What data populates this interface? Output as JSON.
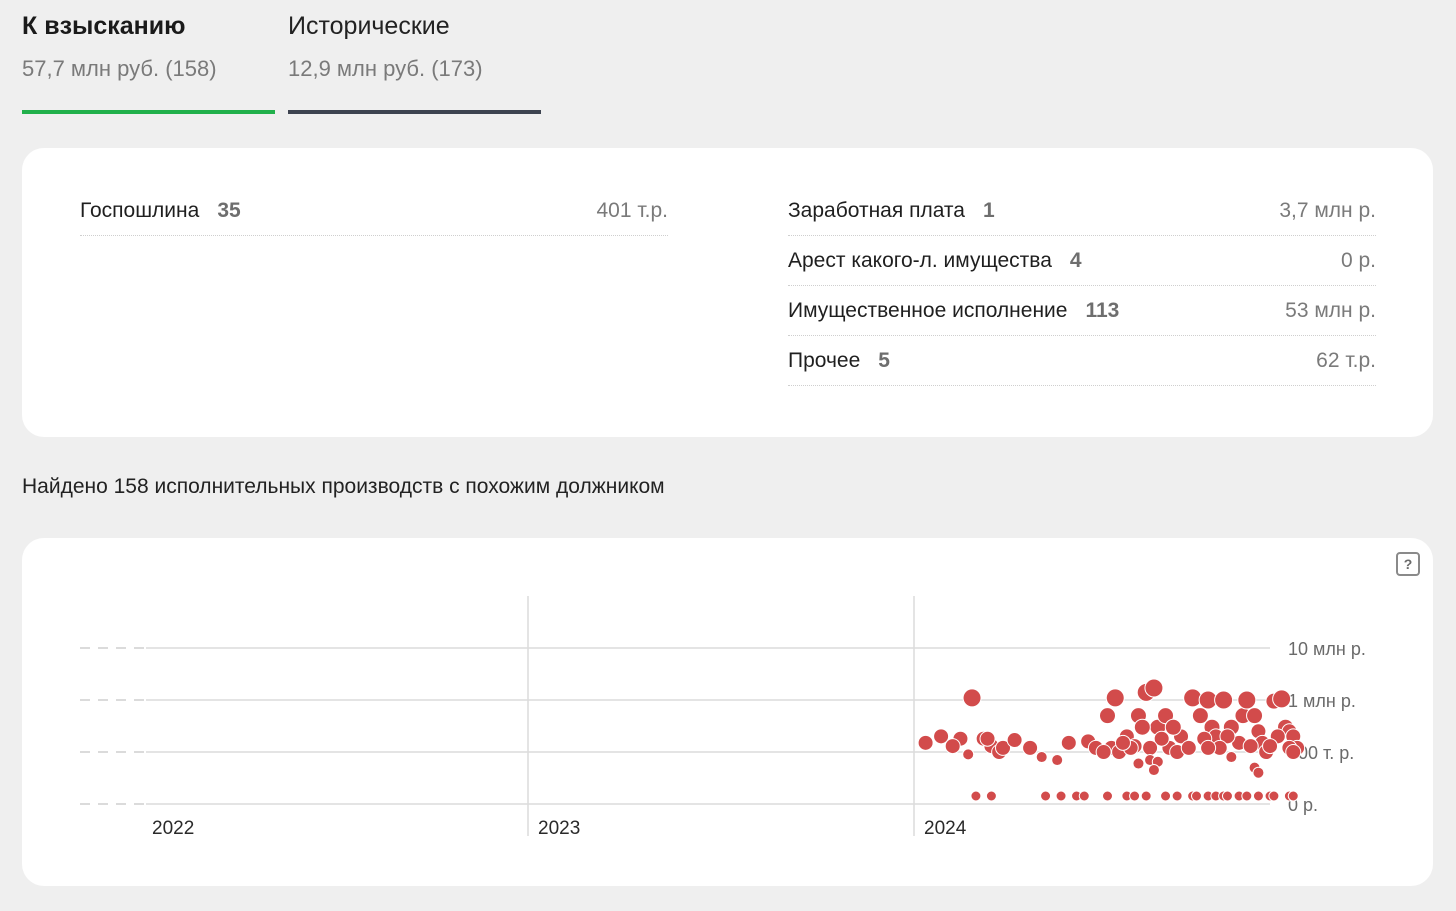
{
  "tabs": [
    {
      "title": "К взысканию",
      "subtitle": "57,7 млн руб. (158)",
      "active": true,
      "bar_color": "#21b04b"
    },
    {
      "title": "Исторические",
      "subtitle": "12,9 млн руб. (173)",
      "active": false,
      "bar_color": "#3d4350"
    }
  ],
  "summary": {
    "left": [
      {
        "label": "Госпошлина",
        "count": "35",
        "amount": "401 т.р."
      }
    ],
    "right": [
      {
        "label": "Заработная плата",
        "count": "1",
        "amount": "3,7 млн р."
      },
      {
        "label": "Арест какого-л. имущества",
        "count": "4",
        "amount": "0 р."
      },
      {
        "label": "Имущественное исполнение",
        "count": "113",
        "amount": "53 млн р."
      },
      {
        "label": "Прочее",
        "count": "5",
        "amount": "62 т.р."
      }
    ]
  },
  "found_text": "Найдено 158 исполнительных производств с похожим должником",
  "help_icon": "help-icon",
  "chart_data": {
    "type": "scatter",
    "x_tick_labels": [
      "2022",
      "2023",
      "2024"
    ],
    "y_tick_labels": [
      "10 млн р.",
      "1 млн р.",
      "100 т. р.",
      "0 р."
    ],
    "y_scale": "log",
    "point_color": "#d24b4b",
    "x_range": [
      2021.75,
      2025.0
    ],
    "points": [
      [
        2024.03,
        150000
      ],
      [
        2024.07,
        200000
      ],
      [
        2024.12,
        180000
      ],
      [
        2024.15,
        1100000
      ],
      [
        2024.1,
        130000
      ],
      [
        2024.14,
        90000
      ],
      [
        2024.18,
        180000
      ],
      [
        2024.2,
        130000
      ],
      [
        2024.22,
        100000
      ],
      [
        2024.19,
        180000
      ],
      [
        2024.23,
        120000
      ],
      [
        2024.26,
        170000
      ],
      [
        2024.3,
        120000
      ],
      [
        2024.33,
        80000
      ],
      [
        2024.37,
        70000
      ],
      [
        2024.4,
        150000
      ],
      [
        2024.45,
        160000
      ],
      [
        2024.47,
        120000
      ],
      [
        2024.52,
        1100000
      ],
      [
        2024.5,
        500000
      ],
      [
        2024.51,
        120000
      ],
      [
        2024.53,
        100000
      ],
      [
        2024.55,
        200000
      ],
      [
        2024.57,
        130000
      ],
      [
        2024.56,
        120000
      ],
      [
        2024.58,
        500000
      ],
      [
        2024.6,
        1400000
      ],
      [
        2024.62,
        1700000
      ],
      [
        2024.63,
        300000
      ],
      [
        2024.65,
        500000
      ],
      [
        2024.66,
        120000
      ],
      [
        2024.68,
        100000
      ],
      [
        2024.69,
        200000
      ],
      [
        2024.72,
        1100000
      ],
      [
        2024.74,
        500000
      ],
      [
        2024.76,
        1000000
      ],
      [
        2024.77,
        300000
      ],
      [
        2024.78,
        200000
      ],
      [
        2024.8,
        1000000
      ],
      [
        2024.82,
        300000
      ],
      [
        2024.84,
        150000
      ],
      [
        2024.85,
        500000
      ],
      [
        2024.86,
        1000000
      ],
      [
        2024.88,
        500000
      ],
      [
        2024.89,
        250000
      ],
      [
        2024.9,
        150000
      ],
      [
        2024.91,
        100000
      ],
      [
        2024.93,
        950000
      ],
      [
        2024.95,
        1050000
      ],
      [
        2024.96,
        300000
      ],
      [
        2024.97,
        250000
      ],
      [
        2024.98,
        200000
      ],
      [
        2024.99,
        120000
      ],
      [
        2024.94,
        200000
      ],
      [
        2024.92,
        130000
      ],
      [
        2024.87,
        130000
      ],
      [
        2024.81,
        200000
      ],
      [
        2024.79,
        120000
      ],
      [
        2024.75,
        180000
      ],
      [
        2024.71,
        120000
      ],
      [
        2024.67,
        300000
      ],
      [
        2024.64,
        180000
      ],
      [
        2024.61,
        120000
      ],
      [
        2024.59,
        300000
      ],
      [
        2024.54,
        150000
      ],
      [
        2024.49,
        100000
      ],
      [
        2024.61,
        70000
      ],
      [
        2024.63,
        65000
      ],
      [
        2024.58,
        60000
      ],
      [
        2024.62,
        45000
      ],
      [
        2024.76,
        120000
      ],
      [
        2024.82,
        80000
      ],
      [
        2024.88,
        50000
      ],
      [
        2024.89,
        40000
      ],
      [
        2024.97,
        120000
      ],
      [
        2024.98,
        100000
      ],
      [
        2024.16,
        0
      ],
      [
        2024.2,
        0
      ],
      [
        2024.34,
        0
      ],
      [
        2024.38,
        0
      ],
      [
        2024.42,
        0
      ],
      [
        2024.44,
        0
      ],
      [
        2024.5,
        0
      ],
      [
        2024.55,
        0
      ],
      [
        2024.57,
        0
      ],
      [
        2024.6,
        0
      ],
      [
        2024.65,
        0
      ],
      [
        2024.68,
        0
      ],
      [
        2024.72,
        0
      ],
      [
        2024.73,
        0
      ],
      [
        2024.76,
        0
      ],
      [
        2024.78,
        0
      ],
      [
        2024.8,
        0
      ],
      [
        2024.81,
        0
      ],
      [
        2024.84,
        0
      ],
      [
        2024.86,
        0
      ],
      [
        2024.89,
        0
      ],
      [
        2024.92,
        0
      ],
      [
        2024.93,
        0
      ],
      [
        2024.97,
        0
      ],
      [
        2024.98,
        0
      ]
    ]
  }
}
